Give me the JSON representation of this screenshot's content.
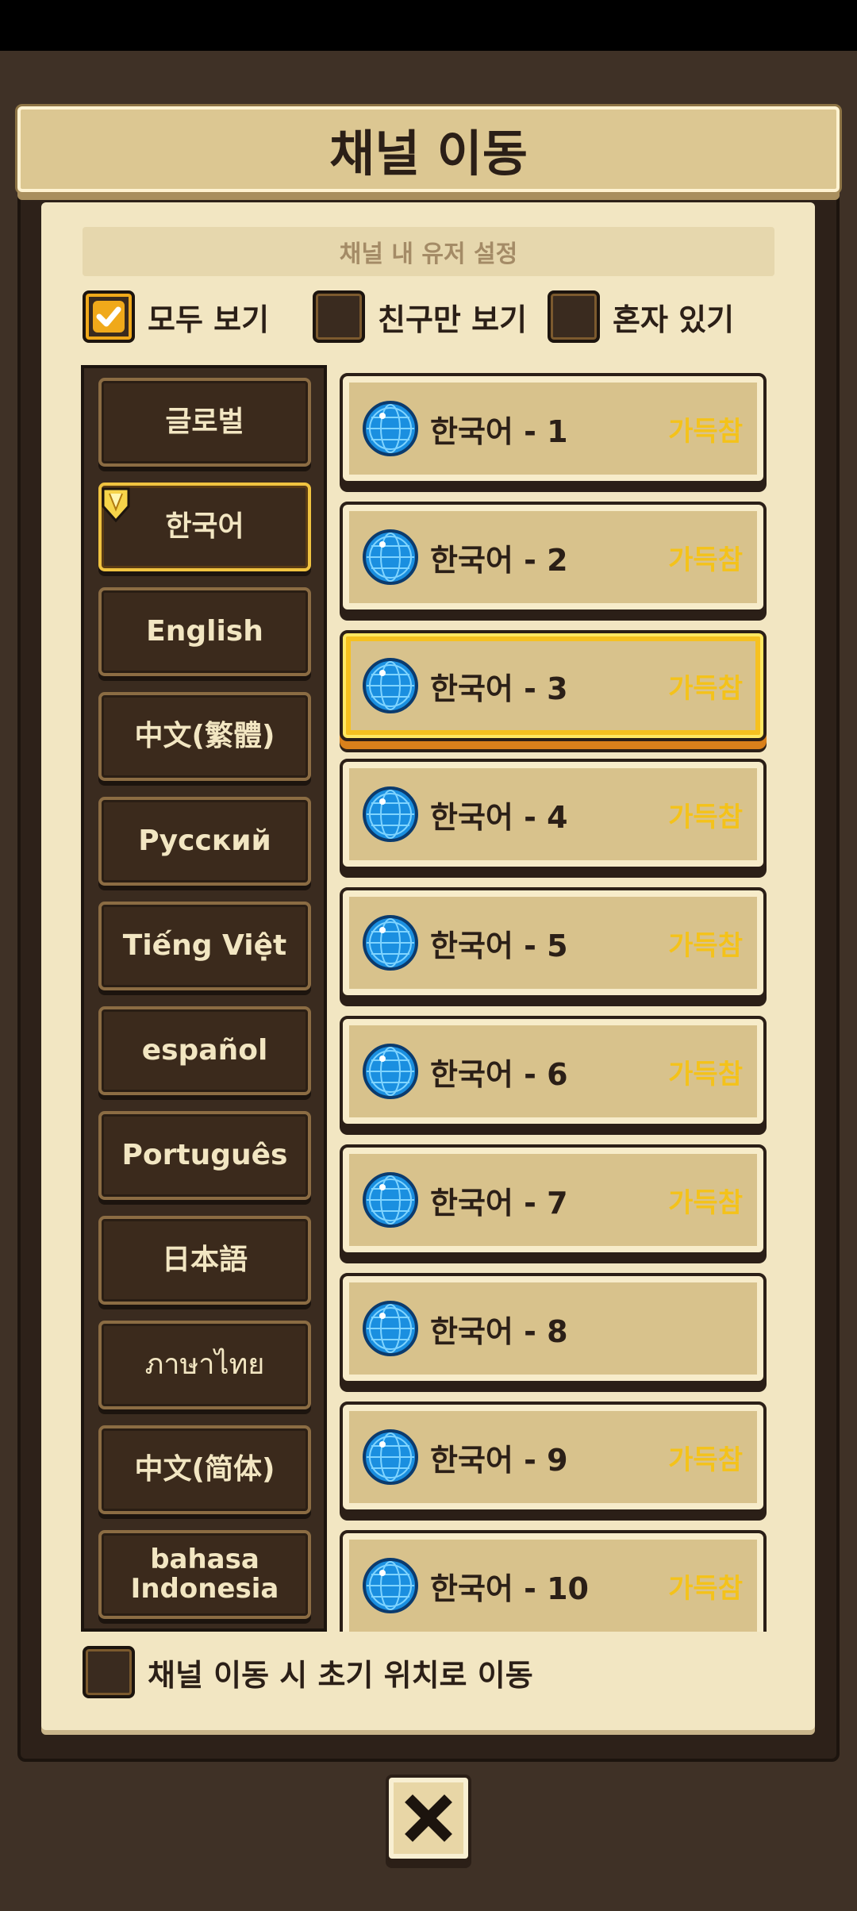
{
  "dialog": {
    "title": "채널 이동"
  },
  "settings": {
    "heading": "채널 내 유저 설정"
  },
  "filters": [
    {
      "label": "모두 보기",
      "checked": true
    },
    {
      "label": "친구만 보기",
      "checked": false
    },
    {
      "label": "혼자 있기",
      "checked": false
    }
  ],
  "languages": [
    {
      "label": "글로벌",
      "active": false
    },
    {
      "label": "한국어",
      "active": true
    },
    {
      "label": "English",
      "active": false
    },
    {
      "label": "中文(繁體)",
      "active": false
    },
    {
      "label": "Русский",
      "active": false
    },
    {
      "label": "Tiếng Việt",
      "active": false
    },
    {
      "label": "español",
      "active": false
    },
    {
      "label": "Português",
      "active": false
    },
    {
      "label": "日本語",
      "active": false
    },
    {
      "label": "ภาษาไทย",
      "active": false
    },
    {
      "label": "中文(简体)",
      "active": false
    },
    {
      "label": "bahasa Indonesia",
      "active": false
    }
  ],
  "channels": [
    {
      "name": "한국어 - 1",
      "status": "가득참"
    },
    {
      "name": "한국어 - 2",
      "status": "가득참"
    },
    {
      "name": "한국어 - 3",
      "status": "가득참",
      "selected": true
    },
    {
      "name": "한국어 - 4",
      "status": "가득참"
    },
    {
      "name": "한국어 - 5",
      "status": "가득참"
    },
    {
      "name": "한국어 - 6",
      "status": "가득참"
    },
    {
      "name": "한국어 - 7",
      "status": "가득참"
    },
    {
      "name": "한국어 - 8",
      "status": ""
    },
    {
      "name": "한국어 - 9",
      "status": "가득참"
    },
    {
      "name": "한국어 - 10",
      "status": "가득참"
    }
  ],
  "bottom_option": {
    "label": "채널 이동 시 초기 위치로 이동",
    "checked": false
  },
  "colors": {
    "accent_gold": "#f4c21a",
    "dark_brown": "#2b1f17",
    "paper": "#f2e6c2"
  },
  "icons": {
    "globe": "globe-icon",
    "close": "close-icon",
    "check": "check-icon",
    "badge": "gold-badge-icon"
  }
}
